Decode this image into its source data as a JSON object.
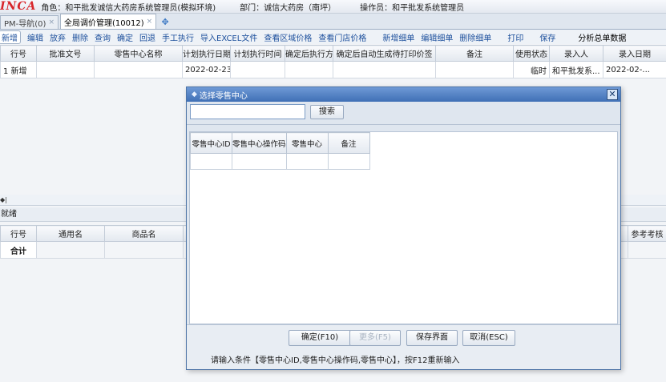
{
  "topbar": {
    "logo": "INCA",
    "role": "角色：和平批发诚信大药房系统管理员(模拟环境)",
    "department": "部门：诚信大药房（南坪）",
    "operator": "操作员：和平批发系统管理员"
  },
  "tabs": [
    {
      "label": "PM-导航(0)",
      "close": "×"
    },
    {
      "label": "全局调价管理(10012)",
      "close": "×"
    }
  ],
  "tab_add": "✥",
  "toolbar": {
    "items": [
      "新增",
      "编辑",
      "放弃",
      "删除",
      "查询",
      "确定",
      "回退",
      "手工执行",
      "导入EXCEL文件",
      "查看区域价格",
      "查看门店价格",
      "新增细单",
      "编辑细单",
      "删除细单",
      "打印",
      "保存"
    ],
    "analysis": "分析总单数据"
  },
  "grid1": {
    "headers": [
      "行号",
      "批准文号",
      "零售中心名称",
      "计划执行日期",
      "计划执行时间",
      "确定后执行方式",
      "确定后自动生成待打印价签",
      "备注",
      "使用状态",
      "录入人",
      "录入日期"
    ],
    "row": [
      "1 新增",
      "",
      "",
      "2022-02-23",
      "",
      "",
      "",
      "",
      "临时",
      "和平批发系...",
      "2022-02-..."
    ]
  },
  "status_marker": "◆|",
  "ready_text": "就绪",
  "grid2": {
    "headers": [
      "行号",
      "通用名",
      "商品名",
      "参考考核"
    ],
    "total_label": "合计"
  },
  "dialog": {
    "title": "选择零售中心",
    "search_value": "",
    "search_button": "搜索",
    "columns": [
      "零售中心ID",
      "零售中心操作码",
      "零售中心",
      "备注"
    ],
    "buttons": {
      "confirm": "确定(F10)",
      "more": "更多(F5)",
      "save_layout": "保存界面",
      "cancel": "取消(ESC)"
    },
    "hint": "请输入条件【零售中心ID,零售中心操作码,零售中心】，按F12重新输入"
  }
}
